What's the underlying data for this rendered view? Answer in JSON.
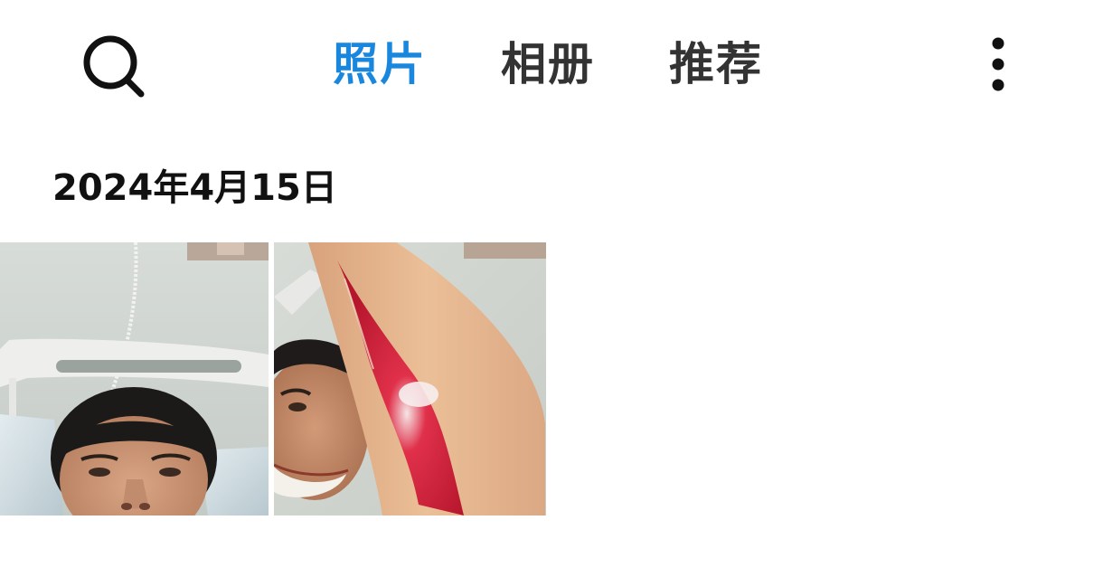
{
  "header": {
    "search_icon": "search-icon",
    "tabs": [
      {
        "label": "照片",
        "active": true
      },
      {
        "label": "相册",
        "active": false
      },
      {
        "label": "推荐",
        "active": false
      }
    ],
    "more_icon": "more-vertical-icon",
    "active_color": "#1a87de",
    "inactive_color": "#333333"
  },
  "gallery": {
    "date_label": "2024年4月15日",
    "photos": [
      {
        "name": "photo-selfie-hospital-bed"
      },
      {
        "name": "photo-arm-wound"
      }
    ]
  }
}
